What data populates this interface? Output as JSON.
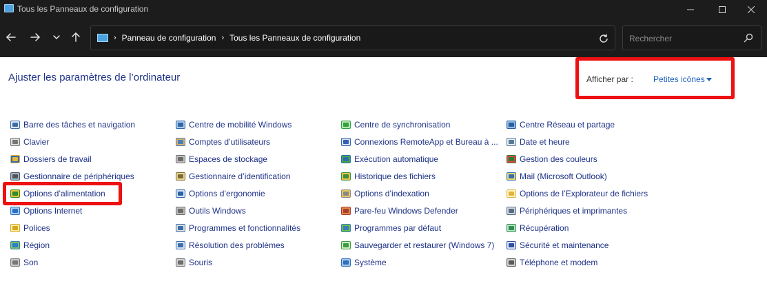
{
  "window": {
    "title": "Tous les Panneaux de configuration"
  },
  "address": {
    "crumb1": "Panneau de configuration",
    "crumb2": "Tous les Panneaux de configuration"
  },
  "search": {
    "placeholder": "Rechercher"
  },
  "page": {
    "title": "Ajuster les paramètres de l’ordinateur",
    "view_label": "Afficher par :",
    "view_value": "Petites icônes"
  },
  "colors": {
    "link": "#1e3287",
    "highlight": "#ee1111",
    "titlebar": "#1c1c1c"
  },
  "items": {
    "c1": [
      {
        "label": "Barre des tâches et navigation",
        "icon": "taskbar-icon"
      },
      {
        "label": "Clavier",
        "icon": "keyboard-icon"
      },
      {
        "label": "Dossiers de travail",
        "icon": "work-folders-icon"
      },
      {
        "label": "Gestionnaire de périphériques",
        "icon": "device-manager-icon"
      },
      {
        "label": "Options d’alimentation",
        "icon": "power-options-icon"
      },
      {
        "label": "Options Internet",
        "icon": "internet-options-icon"
      },
      {
        "label": "Polices",
        "icon": "fonts-icon"
      },
      {
        "label": "Région",
        "icon": "region-icon"
      },
      {
        "label": "Son",
        "icon": "sound-icon"
      }
    ],
    "c2": [
      {
        "label": "Centre de mobilité Windows",
        "icon": "mobility-center-icon"
      },
      {
        "label": "Comptes d’utilisateurs",
        "icon": "user-accounts-icon"
      },
      {
        "label": "Espaces de stockage",
        "icon": "storage-spaces-icon"
      },
      {
        "label": "Gestionnaire d’identification",
        "icon": "credential-manager-icon"
      },
      {
        "label": "Options d’ergonomie",
        "icon": "ease-of-access-icon"
      },
      {
        "label": "Outils Windows",
        "icon": "windows-tools-icon"
      },
      {
        "label": "Programmes et fonctionnalités",
        "icon": "programs-features-icon"
      },
      {
        "label": "Résolution des problèmes",
        "icon": "troubleshooting-icon"
      },
      {
        "label": "Souris",
        "icon": "mouse-icon"
      }
    ],
    "c3": [
      {
        "label": "Centre de synchronisation",
        "icon": "sync-center-icon"
      },
      {
        "label": "Connexions RemoteApp et Bureau à ...",
        "icon": "remoteapp-icon"
      },
      {
        "label": "Exécution automatique",
        "icon": "autoplay-icon"
      },
      {
        "label": "Historique des fichiers",
        "icon": "file-history-icon"
      },
      {
        "label": "Options d’indexation",
        "icon": "indexing-options-icon"
      },
      {
        "label": "Pare-feu Windows Defender",
        "icon": "firewall-icon"
      },
      {
        "label": "Programmes par défaut",
        "icon": "default-programs-icon"
      },
      {
        "label": "Sauvegarder et restaurer (Windows 7)",
        "icon": "backup-restore-icon"
      },
      {
        "label": "Système",
        "icon": "system-icon"
      }
    ],
    "c4": [
      {
        "label": "Centre Réseau et partage",
        "icon": "network-sharing-icon"
      },
      {
        "label": "Date et heure",
        "icon": "date-time-icon"
      },
      {
        "label": "Gestion des couleurs",
        "icon": "color-management-icon"
      },
      {
        "label": "Mail (Microsoft Outlook)",
        "icon": "mail-icon"
      },
      {
        "label": "Options de l’Explorateur de fichiers",
        "icon": "explorer-options-icon"
      },
      {
        "label": "Périphériques et imprimantes",
        "icon": "devices-printers-icon"
      },
      {
        "label": "Récupération",
        "icon": "recovery-icon"
      },
      {
        "label": "Sécurité et maintenance",
        "icon": "security-maintenance-icon"
      },
      {
        "label": "Téléphone et modem",
        "icon": "phone-modem-icon"
      }
    ]
  }
}
